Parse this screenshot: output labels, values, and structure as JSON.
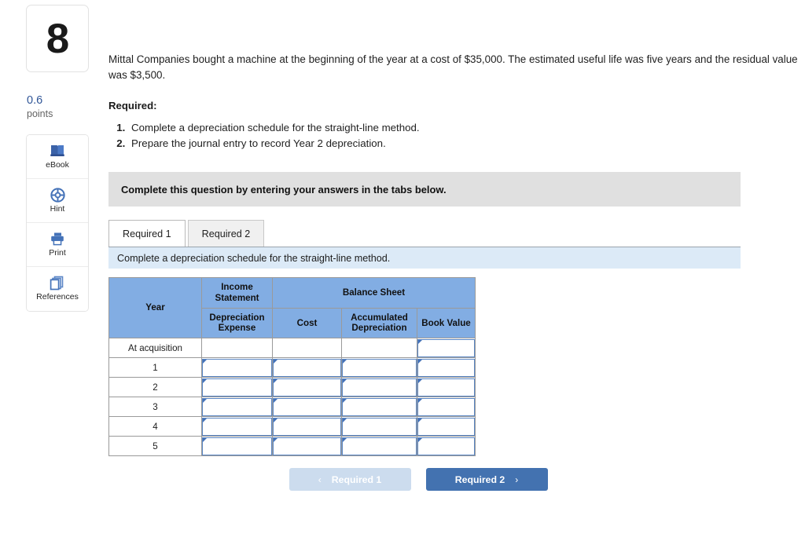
{
  "question": {
    "number": "8",
    "points_value": "0.6",
    "points_label": "points",
    "stem": "Mittal Companies bought a machine at the beginning of the year at a cost of $35,000. The estimated useful life was five years and the residual value was $3,500.",
    "required_heading": "Required:",
    "requirements": [
      "Complete a depreciation schedule for the straight-line method.",
      "Prepare the journal entry to record Year 2 depreciation."
    ]
  },
  "tools": [
    {
      "label": "eBook",
      "icon": "ebook-icon"
    },
    {
      "label": "Hint",
      "icon": "hint-icon"
    },
    {
      "label": "Print",
      "icon": "print-icon"
    },
    {
      "label": "References",
      "icon": "references-icon"
    }
  ],
  "banners": {
    "gray": "Complete this question by entering your answers in the tabs below.",
    "blue": "Complete a depreciation schedule for the straight-line method."
  },
  "tabs": [
    {
      "label": "Required 1",
      "active": true
    },
    {
      "label": "Required 2",
      "active": false
    }
  ],
  "table": {
    "group_headers": {
      "year": "Year",
      "income_statement": "Income Statement",
      "balance_sheet": "Balance Sheet"
    },
    "sub_headers": [
      "Depreciation Expense",
      "Cost",
      "Accumulated Depreciation",
      "Book Value"
    ],
    "rows": [
      {
        "year": "At acquisition",
        "cells": [
          "plain",
          "plain",
          "plain",
          "input"
        ]
      },
      {
        "year": "1",
        "cells": [
          "input",
          "input",
          "input",
          "input"
        ]
      },
      {
        "year": "2",
        "cells": [
          "input",
          "input",
          "input",
          "input"
        ]
      },
      {
        "year": "3",
        "cells": [
          "input",
          "input",
          "input",
          "input"
        ]
      },
      {
        "year": "4",
        "cells": [
          "input",
          "input",
          "input",
          "input"
        ]
      },
      {
        "year": "5",
        "cells": [
          "input",
          "input",
          "input",
          "input"
        ]
      }
    ]
  },
  "nav": {
    "prev_label": "Required 1",
    "prev_chevron": "‹",
    "next_label": "Required 2",
    "next_chevron": "›"
  },
  "colors": {
    "header_blue": "#82ade3",
    "banner_gray": "#e0e0e0",
    "banner_blue": "#dceaf7",
    "button_blue": "#4372b0",
    "button_disabled": "#ccdcee",
    "input_border": "#5a86c4",
    "points_blue": "#2f5597"
  }
}
